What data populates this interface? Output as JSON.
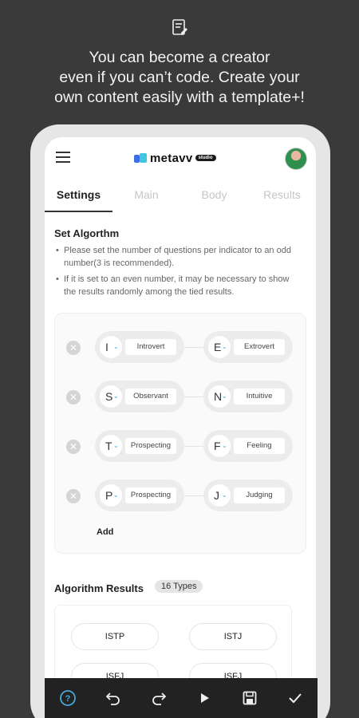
{
  "promo": {
    "icon": "document-edit-icon",
    "lines": [
      "You can become a creator",
      "even if you can’t code. Create your",
      "own content easily with a template+!"
    ]
  },
  "app": {
    "logo_text": "metavv",
    "logo_badge": "studio",
    "menu_icon": "hamburger-menu-icon"
  },
  "tabs": [
    "Settings",
    "Main",
    "Body",
    "Results"
  ],
  "settings": {
    "title": "Set Algorthm",
    "notes": [
      "Please set the number of questions per indicator to an odd number(3 is recommended).",
      "If it is set to an even number, it may be necessary to show the results randomly among the tied results."
    ],
    "rows": [
      {
        "left_letter": "I",
        "left_word": "Introvert",
        "right_letter": "E",
        "right_word": "Extrovert"
      },
      {
        "left_letter": "S",
        "left_word": "Observant",
        "right_letter": "N",
        "right_word": "Intuitive"
      },
      {
        "left_letter": "T",
        "left_word": "Prospecting",
        "right_letter": "F",
        "right_word": "Feeling"
      },
      {
        "left_letter": "P",
        "left_word": "Prospecting",
        "right_letter": "J",
        "right_word": "Judging"
      }
    ],
    "add_label": "Add"
  },
  "results": {
    "title": "Algorithm Results",
    "badge": "16 Types",
    "types": [
      "ISTP",
      "ISTJ",
      "ISFJ",
      "ISFJ"
    ]
  },
  "toolbar": {
    "icons": [
      "help-icon",
      "undo-icon",
      "redo-icon",
      "play-icon",
      "save-icon",
      "check-icon"
    ],
    "accent": "#4aa6d8"
  }
}
